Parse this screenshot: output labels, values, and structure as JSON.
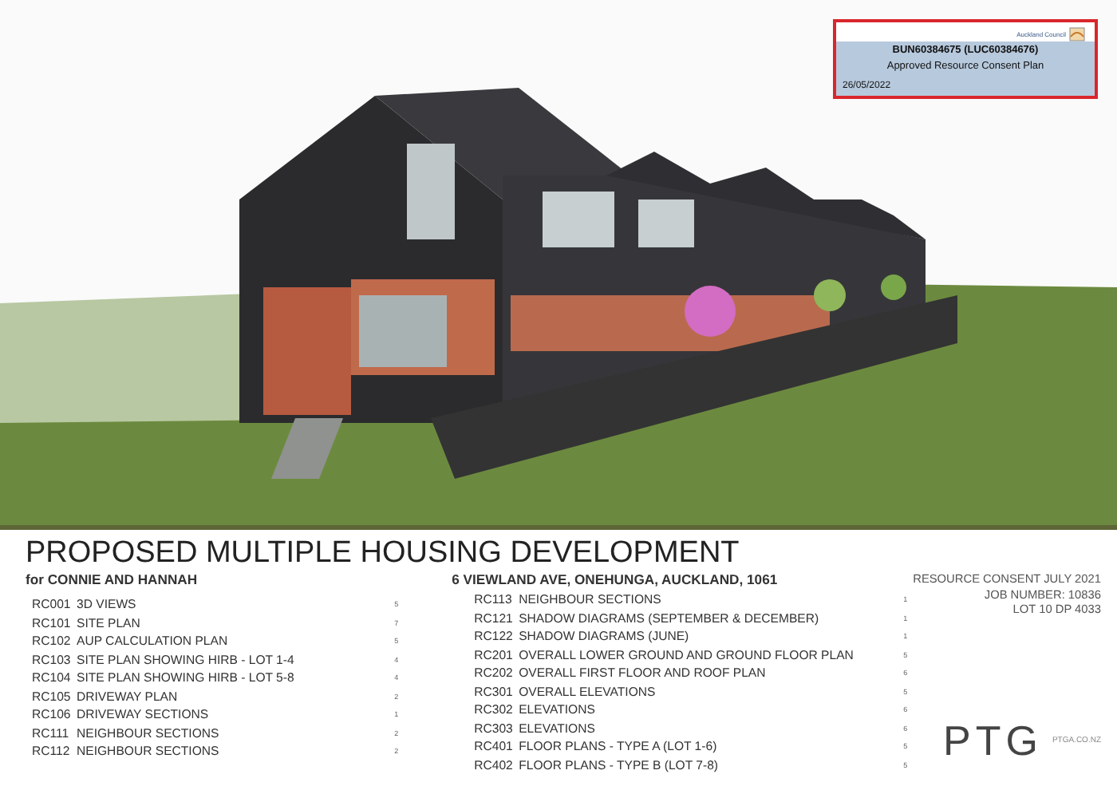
{
  "stamp": {
    "logo_text": "Auckland Council",
    "reference": "BUN60384675 (LUC60384676)",
    "status": "Approved Resource Consent Plan",
    "date": "26/05/2022"
  },
  "title": "PROPOSED MULTIPLE HOUSING DEVELOPMENT",
  "client": "for CONNIE AND HANNAH",
  "address": "6 VIEWLAND AVE, ONEHUNGA, AUCKLAND, 1061",
  "project_info": [
    "RESOURCE CONSENT JULY 2021",
    "JOB NUMBER: 10836",
    "LOT 10 DP 4033"
  ],
  "drawing_list_left": [
    {
      "code": "RC001",
      "name": "3D VIEWS",
      "revision": "5"
    },
    {
      "code": "RC101",
      "name": "SITE PLAN",
      "revision": "7"
    },
    {
      "code": "RC102",
      "name": "AUP CALCULATION PLAN",
      "revision": "5"
    },
    {
      "code": "RC103",
      "name": "SITE PLAN SHOWING HIRB - LOT 1-4",
      "revision": "4"
    },
    {
      "code": "RC104",
      "name": "SITE PLAN SHOWING HIRB - LOT 5-8",
      "revision": "4"
    },
    {
      "code": "RC105",
      "name": "DRIVEWAY PLAN",
      "revision": "2"
    },
    {
      "code": "RC106",
      "name": "DRIVEWAY SECTIONS",
      "revision": "1"
    },
    {
      "code": "RC111",
      "name": "NEIGHBOUR SECTIONS",
      "revision": "2"
    },
    {
      "code": "RC112",
      "name": "NEIGHBOUR SECTIONS",
      "revision": "2"
    }
  ],
  "drawing_list_right": [
    {
      "code": "RC113",
      "name": "NEIGHBOUR SECTIONS",
      "revision": "1"
    },
    {
      "code": "RC121",
      "name": "SHADOW DIAGRAMS (SEPTEMBER & DECEMBER)",
      "revision": "1"
    },
    {
      "code": "RC122",
      "name": "SHADOW DIAGRAMS (JUNE)",
      "revision": "1"
    },
    {
      "code": "RC201",
      "name": "OVERALL LOWER GROUND AND GROUND FLOOR PLAN",
      "revision": "5"
    },
    {
      "code": "RC202",
      "name": "OVERALL FIRST FLOOR AND ROOF PLAN",
      "revision": "6"
    },
    {
      "code": "RC301",
      "name": "OVERALL ELEVATIONS",
      "revision": "5"
    },
    {
      "code": "RC302",
      "name": "ELEVATIONS",
      "revision": "6"
    },
    {
      "code": "RC303",
      "name": "ELEVATIONS",
      "revision": "6"
    },
    {
      "code": "RC401",
      "name": "FLOOR PLANS - TYPE A (LOT 1-6)",
      "revision": "5"
    },
    {
      "code": "RC402",
      "name": "FLOOR PLANS - TYPE B (LOT 7-8)",
      "revision": "5"
    }
  ],
  "firm": {
    "logo": "PTG",
    "website": "PTGA.CO.NZ"
  }
}
